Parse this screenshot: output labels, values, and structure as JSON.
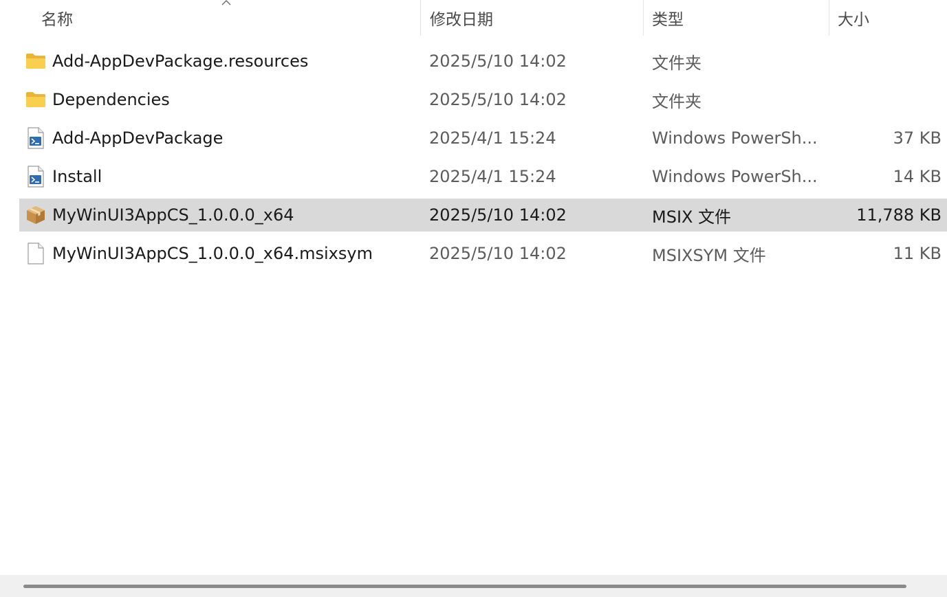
{
  "columns": {
    "name": "名称",
    "date": "修改日期",
    "type": "类型",
    "size": "大小"
  },
  "files": [
    {
      "name": "Add-AppDevPackage.resources",
      "date": "2025/5/10 14:02",
      "type": "文件夹",
      "size": "",
      "icon": "folder-icon"
    },
    {
      "name": "Dependencies",
      "date": "2025/5/10 14:02",
      "type": "文件夹",
      "size": "",
      "icon": "folder-icon"
    },
    {
      "name": "Add-AppDevPackage",
      "date": "2025/4/1 15:24",
      "type": "Windows PowerSh...",
      "size": "37 KB",
      "icon": "powershell-script-icon"
    },
    {
      "name": "Install",
      "date": "2025/4/1 15:24",
      "type": "Windows PowerSh...",
      "size": "14 KB",
      "icon": "powershell-script-icon"
    },
    {
      "name": "MyWinUI3AppCS_1.0.0.0_x64",
      "date": "2025/5/10 14:02",
      "type": "MSIX 文件",
      "size": "11,788 KB",
      "icon": "package-icon",
      "selected": true
    },
    {
      "name": "MyWinUI3AppCS_1.0.0.0_x64.msixsym",
      "date": "2025/5/10 14:02",
      "type": "MSIXSYM 文件",
      "size": "11 KB",
      "icon": "blank-file-icon"
    }
  ],
  "sort": {
    "column": "name",
    "direction": "ascending",
    "icon": "sort-up-icon"
  },
  "colors": {
    "selected_row": "#d9d9d9",
    "folder": "#f7c948",
    "scroll_thumb": "#8a8a8a"
  }
}
